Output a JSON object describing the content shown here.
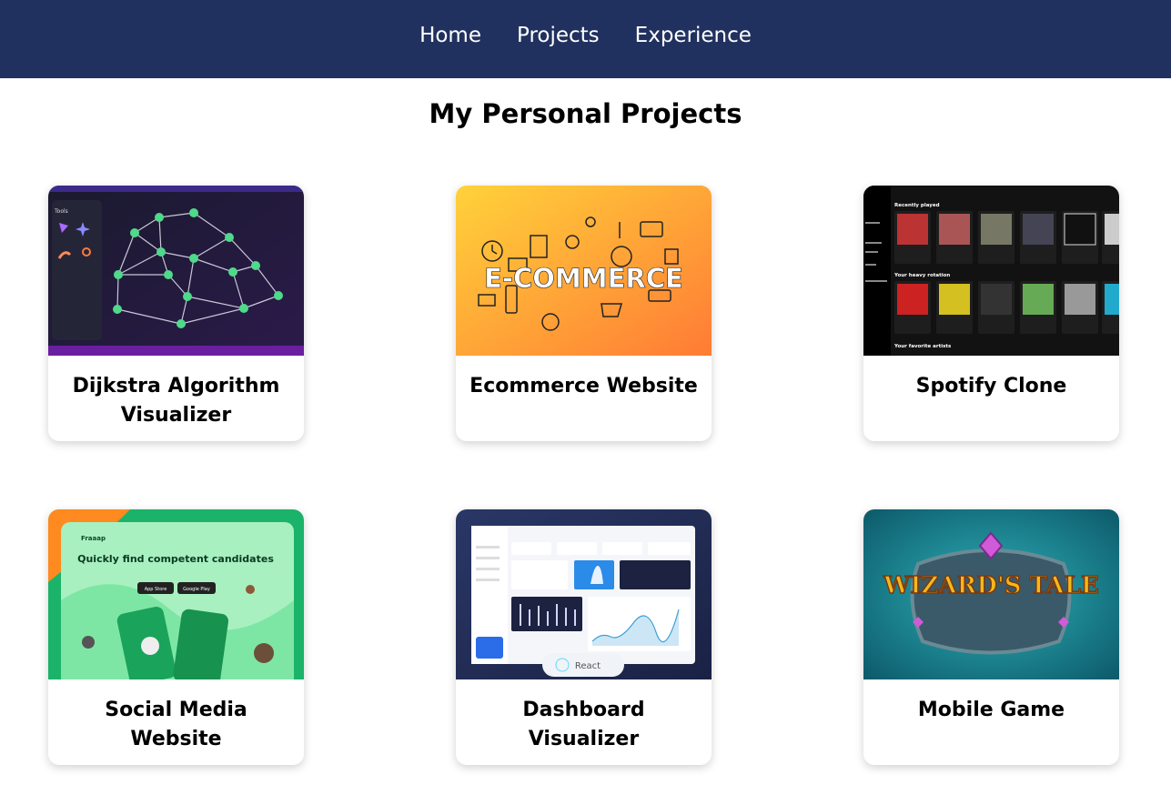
{
  "nav": {
    "items": [
      {
        "label": "Home"
      },
      {
        "label": "Projects"
      },
      {
        "label": "Experience"
      }
    ]
  },
  "page_title": "My Personal Projects",
  "projects": [
    {
      "title": "Dijkstra Algorithm Visualizer",
      "thumb_text": {
        "tools": "Tools"
      }
    },
    {
      "title": "Ecommerce Website",
      "thumb_text": {
        "banner": "E-COMMERCE"
      }
    },
    {
      "title": "Spotify Clone",
      "thumb_text": {
        "recent": "Recently played",
        "heavy": "Your heavy rotation",
        "artists": "Your favorite artists"
      }
    },
    {
      "title": "Social Media Website",
      "thumb_text": {
        "brand": "Fraaap",
        "headline": "Quickly find competent candidates",
        "app_store": "App Store",
        "google_play": "Google Play"
      }
    },
    {
      "title": "Dashboard Visualizer",
      "thumb_text": {
        "badge": "React"
      }
    },
    {
      "title": "Mobile Game",
      "thumb_text": {
        "logo": "WIZARD'S TALE"
      }
    }
  ],
  "colors": {
    "nav_bg": "#21315f",
    "accent_green": "#4fd98a",
    "ecommerce_orange": "#ff9a2b",
    "spotify_bg": "#121212",
    "game_teal": "#1d7e8c"
  }
}
